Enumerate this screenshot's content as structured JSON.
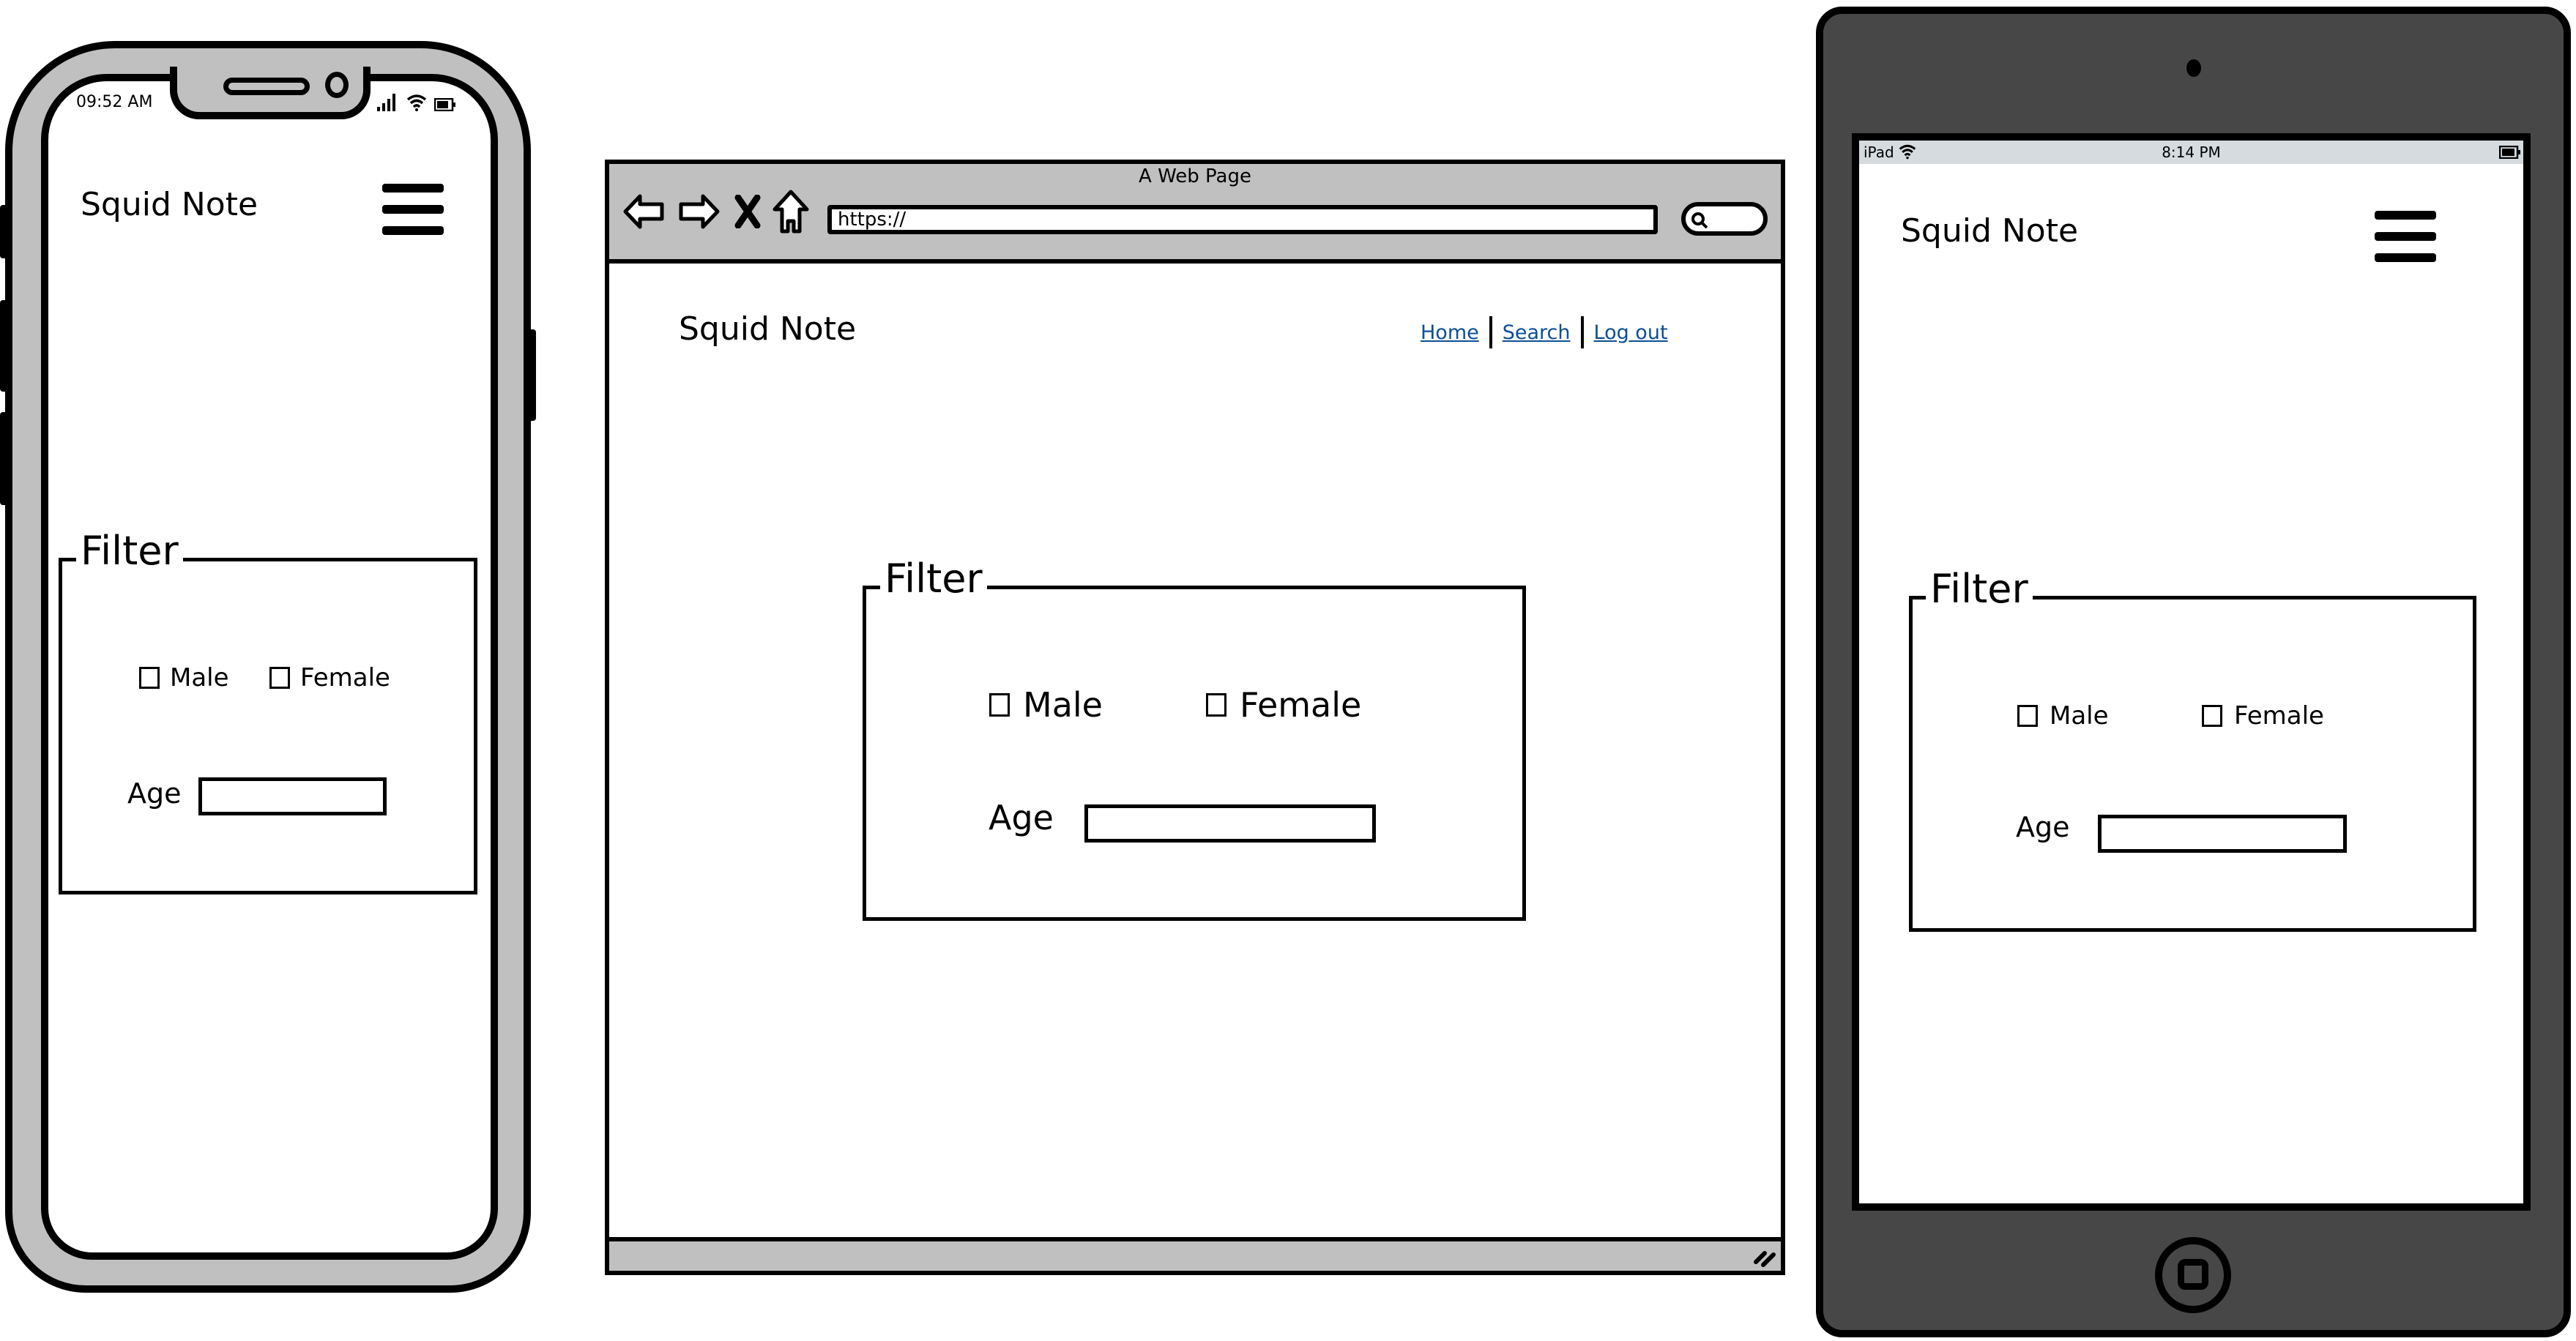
{
  "phone": {
    "status_time": "09:52 AM",
    "status_icons": [
      "signal-icon",
      "wifi-icon",
      "battery-icon"
    ],
    "app_title": "Squid Note",
    "menu_icon": "hamburger-menu-icon",
    "filter": {
      "legend": "Filter",
      "checkboxes": [
        {
          "label": "Male",
          "checked": false
        },
        {
          "label": "Female",
          "checked": false
        }
      ],
      "age_label": "Age",
      "age_value": ""
    }
  },
  "browser": {
    "window_title": "A Web Page",
    "nav_icons": [
      "back-arrow-icon",
      "forward-arrow-icon",
      "stop-icon",
      "home-icon"
    ],
    "url": "https://",
    "search_icon": "search-icon",
    "app_title": "Squid Note",
    "nav_links": [
      {
        "label": "Home"
      },
      {
        "label": "Search"
      },
      {
        "label": "Log out"
      }
    ],
    "link_color": "#0b4f95",
    "filter": {
      "legend": "Filter",
      "checkboxes": [
        {
          "label": "Male",
          "checked": false
        },
        {
          "label": "Female",
          "checked": false
        }
      ],
      "age_label": "Age",
      "age_value": ""
    }
  },
  "tablet": {
    "status_device": "iPad",
    "status_time": "8:14 PM",
    "app_title": "Squid Note",
    "menu_icon": "hamburger-menu-icon",
    "filter": {
      "legend": "Filter",
      "checkboxes": [
        {
          "label": "Male",
          "checked": false
        },
        {
          "label": "Female",
          "checked": false
        }
      ],
      "age_label": "Age",
      "age_value": ""
    }
  },
  "colors": {
    "device_bezel_light": "#c0c0c0",
    "device_bezel_dark": "#474747",
    "tablet_statusbar": "#d5dbdf"
  }
}
